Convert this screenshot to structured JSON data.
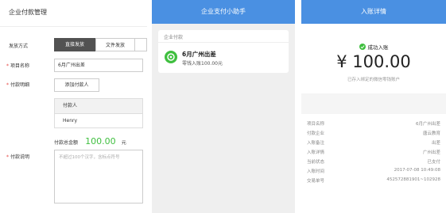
{
  "panel1": {
    "title": "企业付款管理",
    "issue_method_label": "发放方式",
    "option_direct": "直接发放",
    "option_file": "文件发放",
    "project_name_label": "项目名称",
    "project_name_value": "6月广州出差",
    "details_label": "付款明细",
    "add_payer_button": "添加付款人",
    "table_header": "付款人",
    "table_rows": [
      "Henry"
    ],
    "total_label": "付款总金额",
    "total_amount": "100.00",
    "total_unit": "元",
    "description_label": "付款说明",
    "description_placeholder": "不超过100个汉字，含标点符号"
  },
  "panel2": {
    "header": "企业支付小助手",
    "card_title": "企业付款",
    "pay_title": "6月广州出差",
    "pay_sub": "零钱入账100.00元"
  },
  "panel3": {
    "header": "入账详情",
    "success": "成功入账",
    "amount": "¥ 100.00",
    "note": "已存入绑定的微信零钱账户",
    "details": [
      {
        "label": "项目名称",
        "value": "6月广州出差"
      },
      {
        "label": "付款企业",
        "value": "唐云教育"
      },
      {
        "label": "入账备注",
        "value": "出差"
      },
      {
        "label": "入账详情",
        "value": "广州出差"
      },
      {
        "label": "当前状态",
        "value": "已支付"
      },
      {
        "label": "入账时间",
        "value": "2017-07-08 10:49:08"
      },
      {
        "label": "交易单号",
        "value": "452572881901~102928"
      }
    ]
  },
  "colors": {
    "accent": "#4a90e2",
    "green": "#3fbf3f",
    "dark": "#525252"
  }
}
